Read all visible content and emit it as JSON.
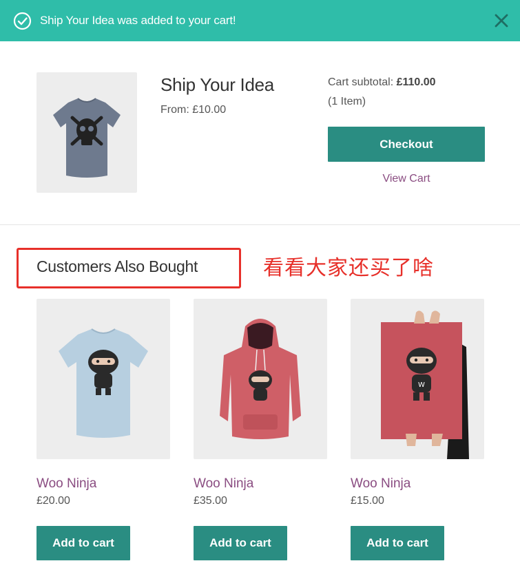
{
  "notice": {
    "message": "Ship Your Idea was added to your cart!",
    "icon": "check-circle-icon",
    "close_icon": "close-icon",
    "bg_color": "#2fbda9"
  },
  "added_product": {
    "title": "Ship Your Idea",
    "price": "From: £10.00",
    "image": "tshirt-skull-image"
  },
  "cart": {
    "subtotal_label": "Cart subtotal:",
    "subtotal_value": "£110.00",
    "items": "(1 Item)",
    "checkout_label": "Checkout",
    "view_cart_label": "View Cart"
  },
  "related": {
    "title": "Customers Also Bought",
    "annotation": "看看大家还买了啥",
    "products": [
      {
        "name": "Woo Ninja",
        "price": "£20.00",
        "button": "Add to cart",
        "image": "ninja-tshirt-image"
      },
      {
        "name": "Woo Ninja",
        "price": "£35.00",
        "button": "Add to cart",
        "image": "ninja-hoodie-image"
      },
      {
        "name": "Woo Ninja",
        "price": "£15.00",
        "button": "Add to cart",
        "image": "ninja-poster-image"
      }
    ]
  },
  "colors": {
    "accent": "#2a8d82",
    "link": "#8a4c81",
    "annotation": "#e7302a"
  }
}
